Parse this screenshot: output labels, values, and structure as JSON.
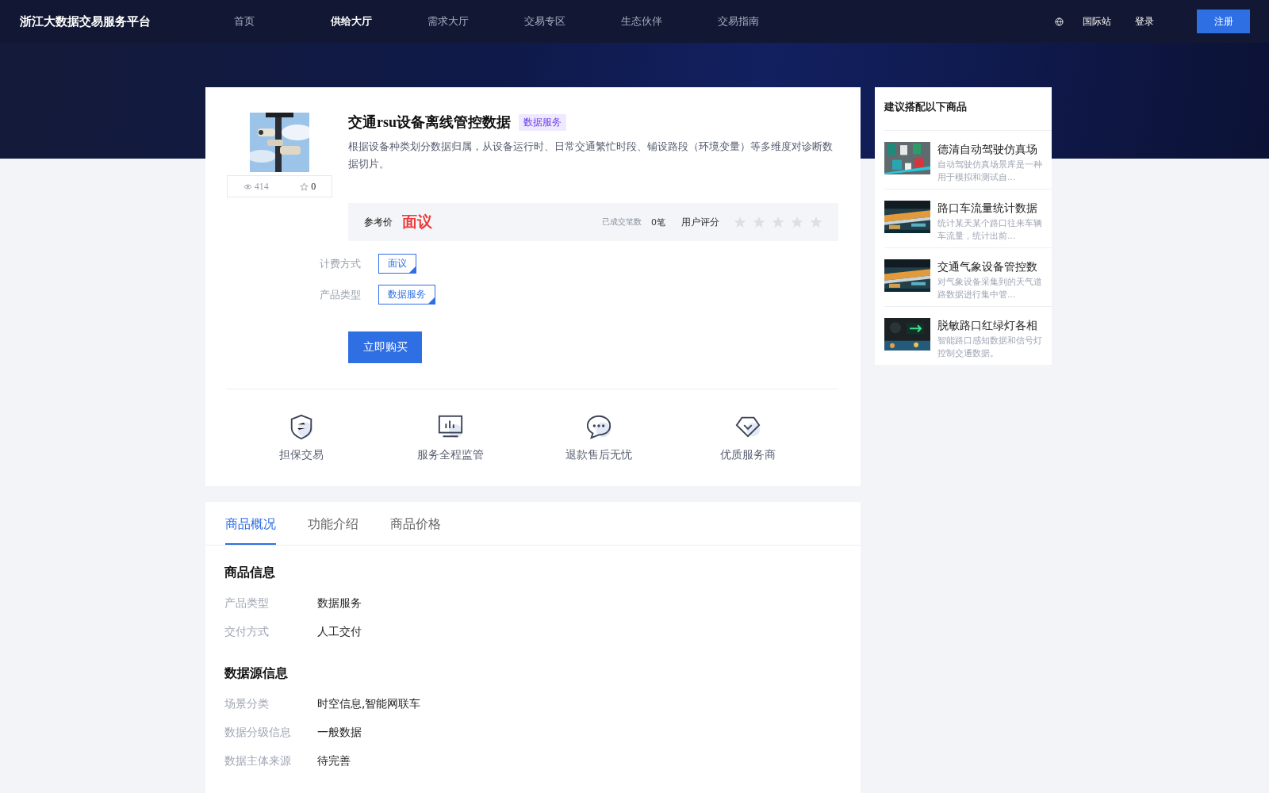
{
  "header": {
    "logo": "浙江大数据交易服务平台",
    "nav": [
      {
        "label": "首页",
        "selected": false
      },
      {
        "label": "供给大厅",
        "selected": true
      },
      {
        "label": "需求大厅",
        "selected": false
      },
      {
        "label": "交易专区",
        "selected": false
      },
      {
        "label": "生态伙伴",
        "selected": false
      },
      {
        "label": "交易指南",
        "selected": false
      }
    ],
    "language": "国际站",
    "login": "登录",
    "register": "注册"
  },
  "product": {
    "views": "414",
    "favorites": "0",
    "title": "交通rsu设备离线管控数据",
    "tag": "数据服务",
    "description": "根据设备种类划分数据归属，从设备运行时、日常交通繁忙时段、铺设路段（环境变量）等多维度对诊断数据切片。",
    "price_label": "参考价",
    "price": "面议",
    "deals_label": "已成交笔数",
    "deals": "0笔",
    "rating_label": "用户评分",
    "stars": 0,
    "options": [
      {
        "label": "计费方式",
        "value": "面议"
      },
      {
        "label": "产品类型",
        "value": "数据服务"
      }
    ],
    "buy": "立即购买",
    "guarantees": [
      {
        "kind": "shield",
        "label": "担保交易"
      },
      {
        "kind": "monitor",
        "label": "服务全程监管"
      },
      {
        "kind": "chat",
        "label": "退款售后无忧"
      },
      {
        "kind": "diamond",
        "label": "优质服务商"
      }
    ]
  },
  "tabs": [
    {
      "label": "商品概况",
      "selected": true
    },
    {
      "label": "功能介绍",
      "selected": false
    },
    {
      "label": "商品价格",
      "selected": false
    }
  ],
  "sections": [
    {
      "title": "商品信息",
      "rows": [
        {
          "label": "产品类型",
          "value": "数据服务"
        },
        {
          "label": "交付方式",
          "value": "人工交付"
        }
      ]
    },
    {
      "title": "数据源信息",
      "rows": [
        {
          "label": "场景分类",
          "value": "时空信息,智能网联车"
        },
        {
          "label": "数据分级信息",
          "value": "一般数据"
        },
        {
          "label": "数据主体来源",
          "value": "待完善"
        }
      ]
    }
  ],
  "recommend": {
    "title": "建议搭配以下商品",
    "items": [
      {
        "kind": "cars",
        "title": "德清自动驾驶仿真场",
        "description": "自动驾驶仿真场景库是一种用于模拟和测试自..."
      },
      {
        "kind": "street",
        "title": "路口车流量统计数据",
        "description": "统计某天某个路口往来车辆车流量，统计出前..."
      },
      {
        "kind": "street",
        "title": "交通气象设备管控数",
        "description": "对气象设备采集到的天气道路数据进行集中管..."
      },
      {
        "kind": "signal",
        "title": "脱敏路口红绿灯各相",
        "description": "智能路口感知数据和信号灯控制交通数据。"
      }
    ]
  }
}
